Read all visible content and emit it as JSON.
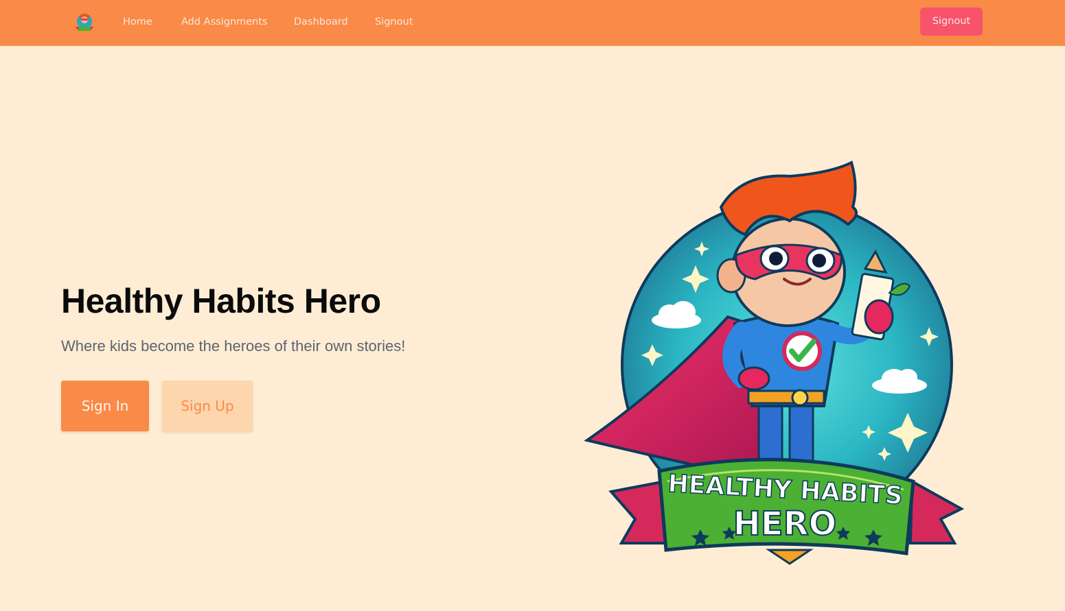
{
  "navbar": {
    "logo_icon": "superhero-logo-icon",
    "links": [
      {
        "label": "Home"
      },
      {
        "label": "Add Assignments"
      },
      {
        "label": "Dashboard"
      },
      {
        "label": "Signout"
      }
    ],
    "signout_button": "Signout"
  },
  "hero": {
    "title": "Healthy Habits Hero",
    "subtitle": "Where kids become the heroes of their own stories!",
    "signin_label": "Sign In",
    "signup_label": "Sign Up",
    "logo": {
      "banner_line1": "HEALTHY HABITS",
      "banner_line2": "HERO"
    }
  },
  "colors": {
    "navbar": "#FA8A47",
    "background": "#FEEDD4",
    "signout_button": "#F7546B",
    "signin_button": "#FA8A47",
    "signup_button": "#FDD6AE"
  }
}
